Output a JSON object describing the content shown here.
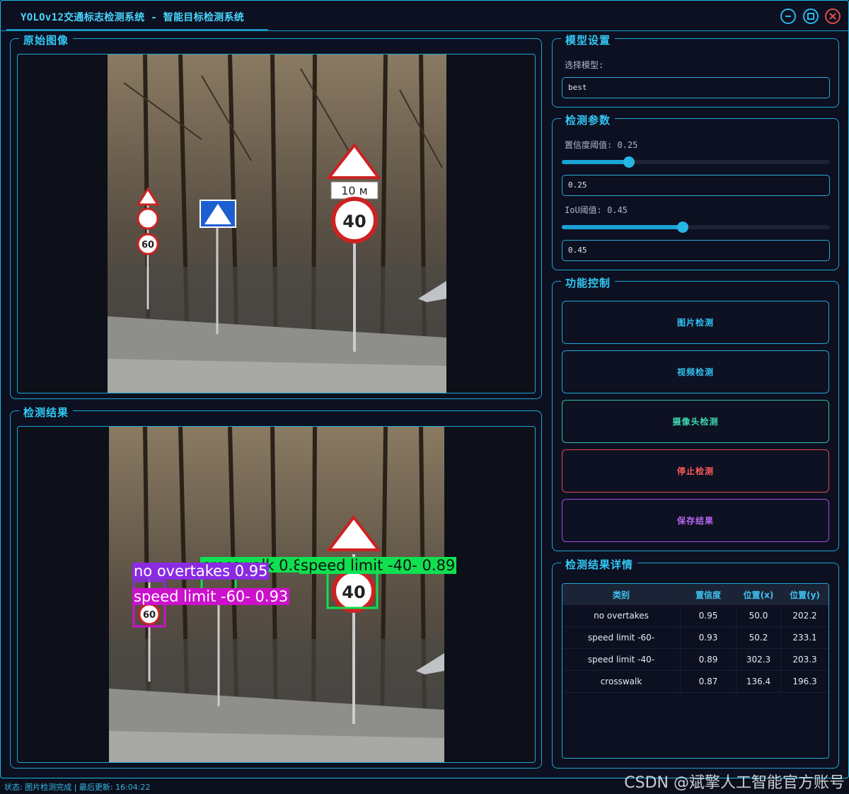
{
  "window": {
    "title": "YOLOv12交通标志检测系统 - 智能目标检测系统"
  },
  "panels": {
    "original": "原始图像",
    "result": "检测结果",
    "model": "模型设置",
    "params": "检测参数",
    "control": "功能控制",
    "details": "检测结果详情"
  },
  "model": {
    "label": "选择模型:",
    "value": "best"
  },
  "params": {
    "conf_label": "置信度阈值: 0.25",
    "conf_value": "0.25",
    "conf_level": 0.25,
    "iou_label": "IoU阈值: 0.45",
    "iou_value": "0.45",
    "iou_level": 0.45
  },
  "buttons": {
    "image": "图片检测",
    "video": "视频检测",
    "camera": "摄像头检测",
    "stop": "停止检测",
    "save": "保存结果"
  },
  "table": {
    "headers": [
      "类别",
      "置信度",
      "位置(x)",
      "位置(y)"
    ],
    "rows": [
      [
        "no overtakes",
        "0.95",
        "50.0",
        "202.2"
      ],
      [
        "speed limit -60-",
        "0.93",
        "50.2",
        "233.1"
      ],
      [
        "speed limit -40-",
        "0.89",
        "302.3",
        "203.3"
      ],
      [
        "crosswalk",
        "0.87",
        "136.4",
        "196.3"
      ]
    ]
  },
  "signs": {
    "distance": "10 м",
    "limit40": "40",
    "limit60": "60"
  },
  "detections": [
    {
      "text": "no overtakes 0.95",
      "color": "#8a2be2"
    },
    {
      "text": "speed limit -60- 0.93",
      "color": "#cc11cc"
    },
    {
      "text": "speed limit -40- 0.89",
      "color": "#10e050"
    },
    {
      "text": "crosswalk 0.87",
      "color": "#10e050"
    }
  ],
  "colors": {
    "accent": "#1fa6d4",
    "stop": "#e04c4c",
    "save": "#a84ce0",
    "camera": "#2fbfa0"
  },
  "status": "状态: 图片检测完成 | 最后更新: 16:04:22",
  "watermark": "CSDN @斌擎人工智能官方账号"
}
